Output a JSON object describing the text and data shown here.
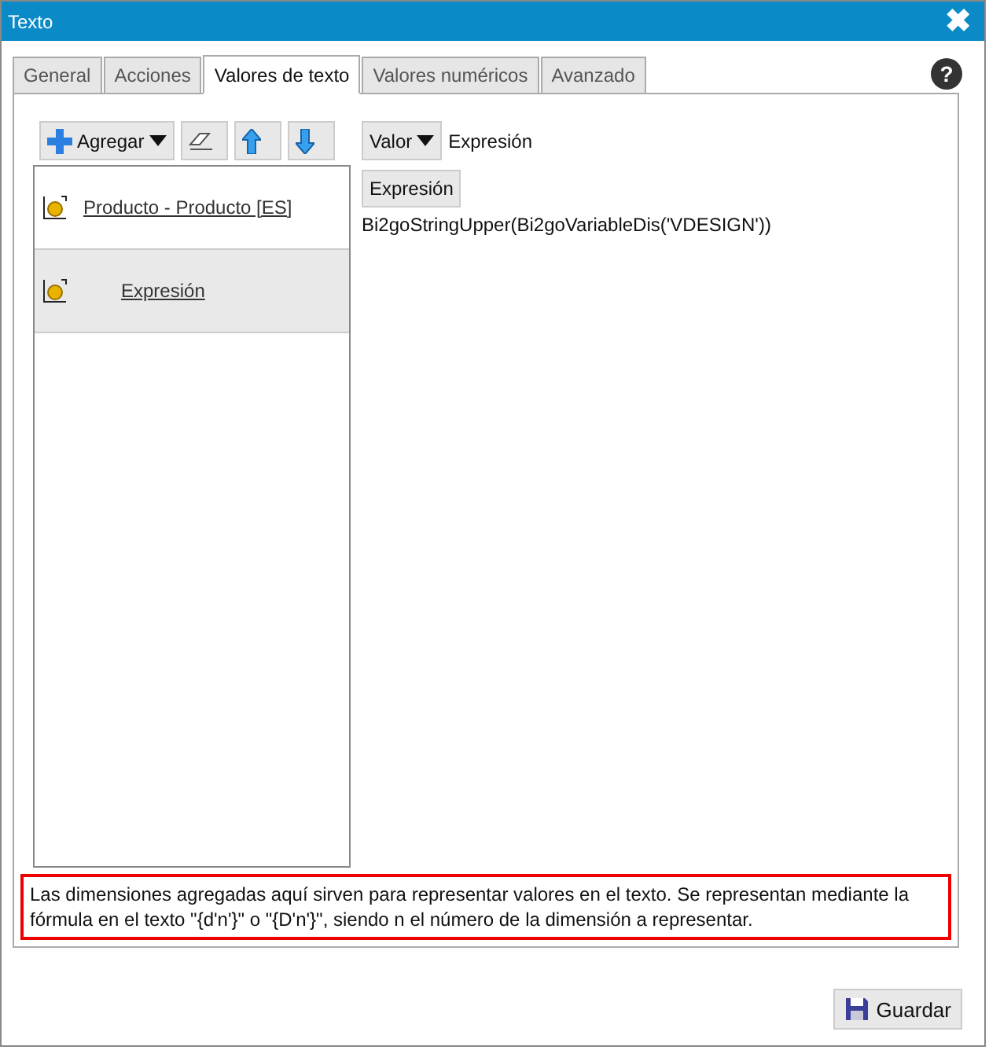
{
  "window": {
    "title": "Texto",
    "close": "✖"
  },
  "tabs": [
    {
      "label": "General",
      "selected": false
    },
    {
      "label": "Acciones",
      "selected": false
    },
    {
      "label": "Valores de texto",
      "selected": true
    },
    {
      "label": "Valores numéricos",
      "selected": false
    },
    {
      "label": "Avanzado",
      "selected": false
    }
  ],
  "help": "?",
  "toolbar": {
    "add_button": "Agregar"
  },
  "items": [
    {
      "label": "Producto - Producto [ES]",
      "selected": false
    },
    {
      "label": "Expresión",
      "selected": true
    }
  ],
  "detail": {
    "type_dropdown": "Valor",
    "type_label": "Expresión",
    "expression_button": "Expresión",
    "expression": "Bi2goStringUpper(Bi2goVariableDis('VDESIGN'))"
  },
  "hint": "Las dimensiones agregadas aquí sirven para representar valores en el texto. Se representan mediante la fórmula en el texto \"{d'n'}\" o \"{D'n'}\", siendo n el número de la dimensión a representar.",
  "save_button": "Guardar"
}
